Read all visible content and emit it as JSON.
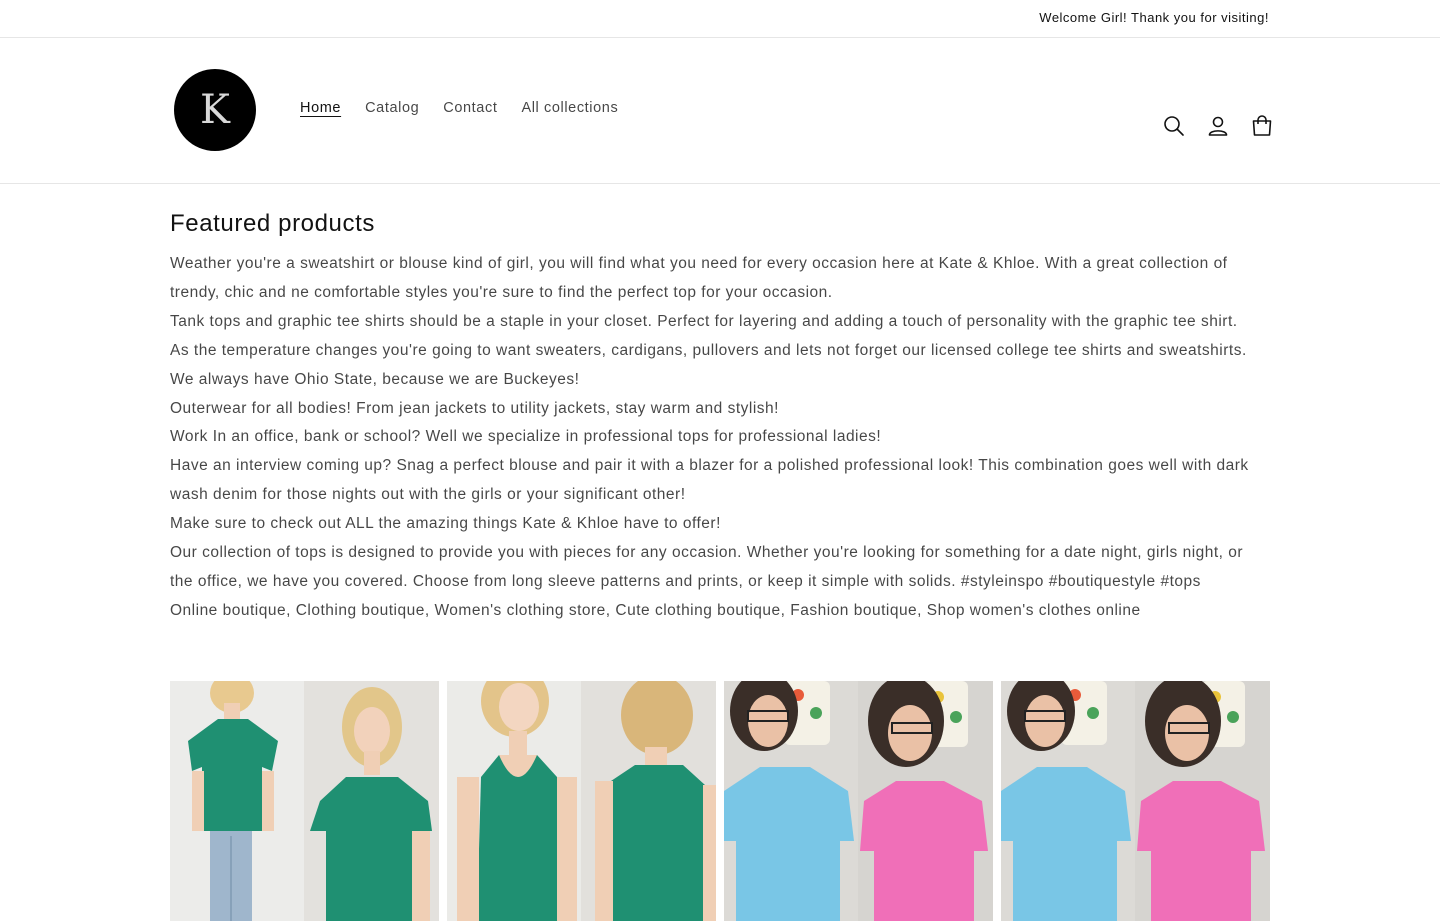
{
  "announcement": {
    "text": "Welcome Girl! Thank you for visiting!"
  },
  "header": {
    "logo_letter": "K",
    "nav": [
      {
        "label": "Home",
        "active": true
      },
      {
        "label": "Catalog",
        "active": false
      },
      {
        "label": "Contact",
        "active": false
      },
      {
        "label": "All collections",
        "active": false
      }
    ],
    "icons": [
      "search-icon",
      "account-icon",
      "cart-icon"
    ]
  },
  "main": {
    "title": "Featured products",
    "paragraphs": [
      "Weather you're a sweatshirt or blouse kind of girl, you will find what you need for every occasion here at Kate & Khloe. With a great collection of trendy, chic and ne comfortable styles you're sure to find the perfect top for your occasion.",
      "Tank tops and graphic tee shirts should be a staple in your closet. Perfect for layering and adding a touch of personality with the graphic tee shirt.",
      "As the temperature changes you're going to want sweaters, cardigans, pullovers and lets not forget our licensed college tee shirts and sweatshirts. We always have Ohio State, because we are Buckeyes!",
      "Outerwear for all bodies! From jean jackets to utility jackets, stay warm and stylish!",
      "Work In an office, bank or school? Well we specialize in professional tops for professional ladies!",
      "Have an interview coming up? Snag a perfect blouse and pair it with a blazer for a polished professional look! This combination goes well with dark wash denim for those nights out with the girls or your significant other!",
      "Make sure to check out ALL the amazing things Kate & Khloe have to offer!",
      " Our collection of tops is designed to provide you with pieces for any occasion. Whether you're looking for something for a date night, girls night, or the office, we have you covered. Choose from long sleeve patterns and prints, or keep it simple with solids. #styleinspo #boutiquestyle #tops",
      "Online boutique, Clothing boutique, Women's clothing store, Cute clothing boutique, Fashion boutique, Shop women's clothes online"
    ]
  },
  "colors": {
    "teal": "#1f9072",
    "blue_top": "#79c6e6",
    "pink_top": "#f06fb8",
    "text": "#121212"
  }
}
